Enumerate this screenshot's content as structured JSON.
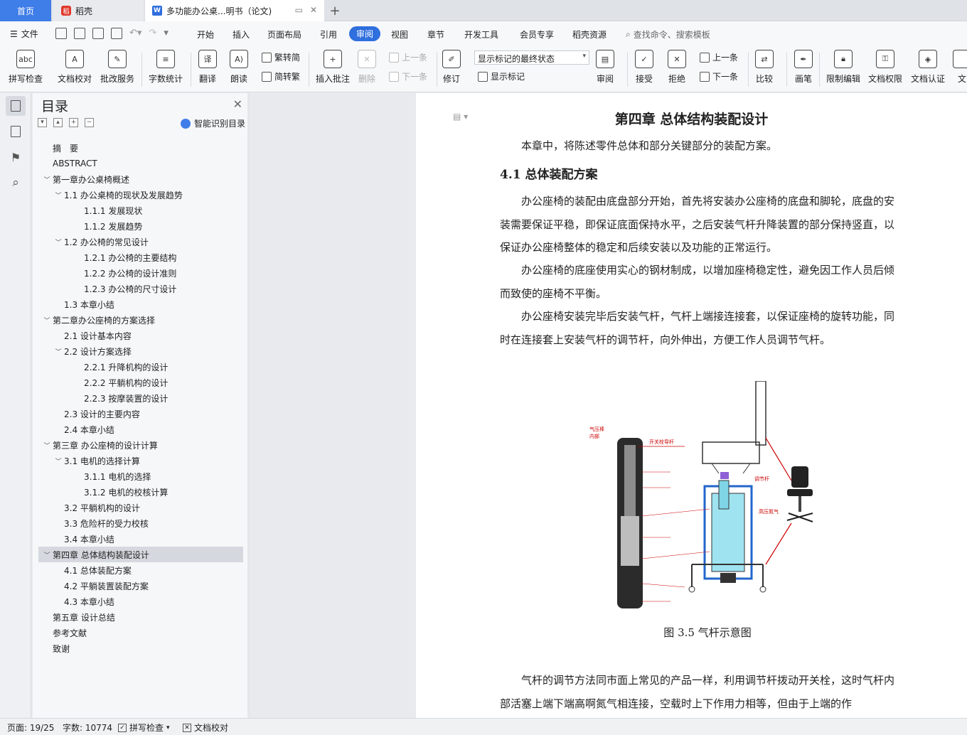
{
  "tabs": {
    "home": "首页",
    "docer": "稻壳",
    "document": "多功能办公桌...明书（论文)",
    "add": "+"
  },
  "menu": {
    "file": "文件",
    "items": [
      "开始",
      "插入",
      "页面布局",
      "引用",
      "审阅",
      "视图",
      "章节",
      "开发工具",
      "会员专享",
      "稻壳资源"
    ],
    "active": "审阅",
    "search": "查找命令、搜索模板"
  },
  "ribbon": {
    "spell_check": "拼写检查",
    "doc_proof": "文档校对",
    "batch_service": "批改服务",
    "word_count": "字数统计",
    "translate": "翻译",
    "read_aloud": "朗读",
    "to_traditional": "繁转简",
    "to_simplified": "简转繁",
    "insert_comment": "插入批注",
    "delete": "删除",
    "prev": "上一条",
    "next": "下一条",
    "track_changes": "修订",
    "markup_state": "显示标记的最终状态",
    "show_markup": "显示标记",
    "review": "审阅",
    "accept": "接受",
    "reject": "拒绝",
    "prev2": "上一条",
    "next2": "下一条",
    "compare": "比较",
    "pen": "画笔",
    "restrict_edit": "限制编辑",
    "doc_permission": "文档权限",
    "doc_auth": "文档认证",
    "more": "文"
  },
  "nav": {
    "title": "目录",
    "smart_toc": "智能识别目录",
    "items": [
      {
        "text": "摘　要",
        "level": 0,
        "chev": ""
      },
      {
        "text": "ABSTRACT",
        "level": 0,
        "chev": ""
      },
      {
        "text": "第一章办公桌椅概述",
        "level": 0,
        "chev": "v"
      },
      {
        "text": "1.1  办公桌椅的现状及发展趋势",
        "level": 1,
        "chev": "v"
      },
      {
        "text": "1.1.1  发展现状",
        "level": 2,
        "chev": ""
      },
      {
        "text": "1.1.2  发展趋势",
        "level": 2,
        "chev": ""
      },
      {
        "text": "1.2 办公椅的常见设计",
        "level": 1,
        "chev": "v"
      },
      {
        "text": "1.2.1  办公椅的主要结构",
        "level": 2,
        "chev": ""
      },
      {
        "text": "1.2.2  办公椅的设计准则",
        "level": 2,
        "chev": ""
      },
      {
        "text": "1.2.3  办公椅的尺寸设计",
        "level": 2,
        "chev": ""
      },
      {
        "text": "1.3  本章小结",
        "level": 1,
        "chev": ""
      },
      {
        "text": "第二章办公座椅的方案选择",
        "level": 0,
        "chev": "v"
      },
      {
        "text": "2.1  设计基本内容",
        "level": 1,
        "chev": ""
      },
      {
        "text": "2.2  设计方案选择",
        "level": 1,
        "chev": "v"
      },
      {
        "text": "2.2.1  升降机构的设计",
        "level": 2,
        "chev": ""
      },
      {
        "text": "2.2.2  平躺机构的设计",
        "level": 2,
        "chev": ""
      },
      {
        "text": "2.2.3  按摩装置的设计",
        "level": 2,
        "chev": ""
      },
      {
        "text": "2.3 设计的主要内容",
        "level": 1,
        "chev": ""
      },
      {
        "text": "2.4  本章小结",
        "level": 1,
        "chev": ""
      },
      {
        "text": "第三章  办公座椅的设计计算",
        "level": 0,
        "chev": "v"
      },
      {
        "text": "3.1 电机的选择计算",
        "level": 1,
        "chev": "v"
      },
      {
        "text": "3.1.1 电机的选择",
        "level": 2,
        "chev": ""
      },
      {
        "text": "3.1.2 电机的校核计算",
        "level": 2,
        "chev": ""
      },
      {
        "text": "3.2 平躺机构的设计",
        "level": 1,
        "chev": ""
      },
      {
        "text": "3.3 危险杆的受力校核",
        "level": 1,
        "chev": ""
      },
      {
        "text": "3.4 本章小结",
        "level": 1,
        "chev": ""
      },
      {
        "text": "第四章  总体结构装配设计",
        "level": 0,
        "chev": "v",
        "selected": true
      },
      {
        "text": "4.1 总体装配方案",
        "level": 1,
        "chev": ""
      },
      {
        "text": "4.2  平躺装置装配方案",
        "level": 1,
        "chev": ""
      },
      {
        "text": "4.3 本章小结",
        "level": 1,
        "chev": ""
      },
      {
        "text": "第五章  设计总结",
        "level": 0,
        "chev": ""
      },
      {
        "text": "参考文献",
        "level": 0,
        "chev": ""
      },
      {
        "text": "致谢",
        "level": 0,
        "chev": ""
      }
    ]
  },
  "document": {
    "chapter_title": "第四章  总体结构装配设计",
    "intro": "本章中，将陈述零件总体和部分关键部分的装配方案。",
    "section_title": "4.1 总体装配方案",
    "para1": "办公座椅的装配由底盘部分开始，首先将安装办公座椅的底盘和脚轮，底盘的安装需要保证平稳，即保证底面保持水平，之后安装气杆升降装置的部分保持竖直，以保证办公座椅整体的稳定和后续安装以及功能的正常运行。",
    "para2": "办公座椅的底座使用实心的钢材制成，以增加座椅稳定性，避免因工作人员后倾而致使的座椅不平衡。",
    "para3": "办公座椅安装完毕后安装气杆，气杆上端接连接套，以保证座椅的旋转功能，同时在连接套上安装气杆的调节杆，向外伸出，方便工作人员调节气杆。",
    "figure_labels": {
      "inner": "气压棒\n内部",
      "switch": "开关栓导杆",
      "adjust": "调节杆",
      "high_pressure": "高压氮气"
    },
    "caption": "图 3.5  气杆示意图",
    "para4": "气杆的调节方法同市面上常见的产品一样，利用调节杆拨动开关栓，这时气杆内部活塞上端下端高啊氮气相连接，空载时上下作用力相等，但由于上端的作"
  },
  "status": {
    "page": "页面: 19/25",
    "words": "字数: 10774",
    "spell": "拼写检查",
    "proof": "文档校对"
  }
}
